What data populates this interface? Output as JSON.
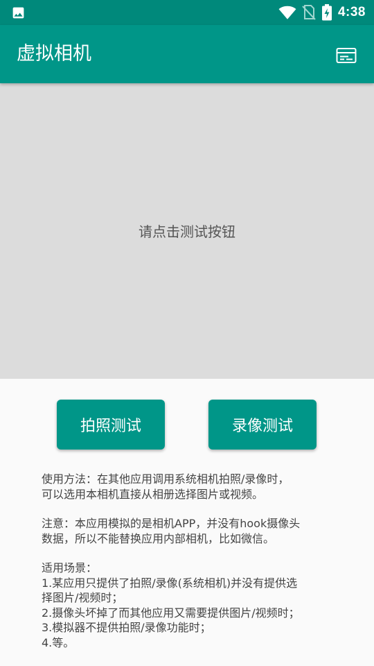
{
  "status_bar": {
    "time": "4:38",
    "icons": [
      "image-icon",
      "wifi-icon",
      "no-sim-icon",
      "battery-charging-icon"
    ]
  },
  "app_bar": {
    "title": "虚拟相机",
    "action_icon": "card-icon"
  },
  "preview": {
    "hint": "请点击测试按钮"
  },
  "buttons": {
    "photo_test": "拍照测试",
    "video_test": "录像测试"
  },
  "notes": {
    "usage_line1": "使用方法：在其他应用调用系统相机拍照/录像时，",
    "usage_line2": "可以选用本相机直接从相册选择图片或视频。",
    "note_line1": "注意：本应用模拟的是相机APP，并没有hook摄像头",
    "note_line2": "数据，所以不能替换应用内部相机，比如微信。",
    "scenes_title": "适用场景：",
    "scene1_line1": "1.某应用只提供了拍照/录像(系统相机)并没有提供选",
    "scene1_line2": "择图片/视频时；",
    "scene2": "2.摄像头坏掉了而其他应用又需要提供图片/视频时；",
    "scene3": "3.模拟器不提供拍照/录像功能时；",
    "scene4": "4.等。"
  },
  "colors": {
    "status_bar": "#00897b",
    "primary": "#009688",
    "preview_bg": "#dcdcdc",
    "page_bg": "#fafafa"
  }
}
